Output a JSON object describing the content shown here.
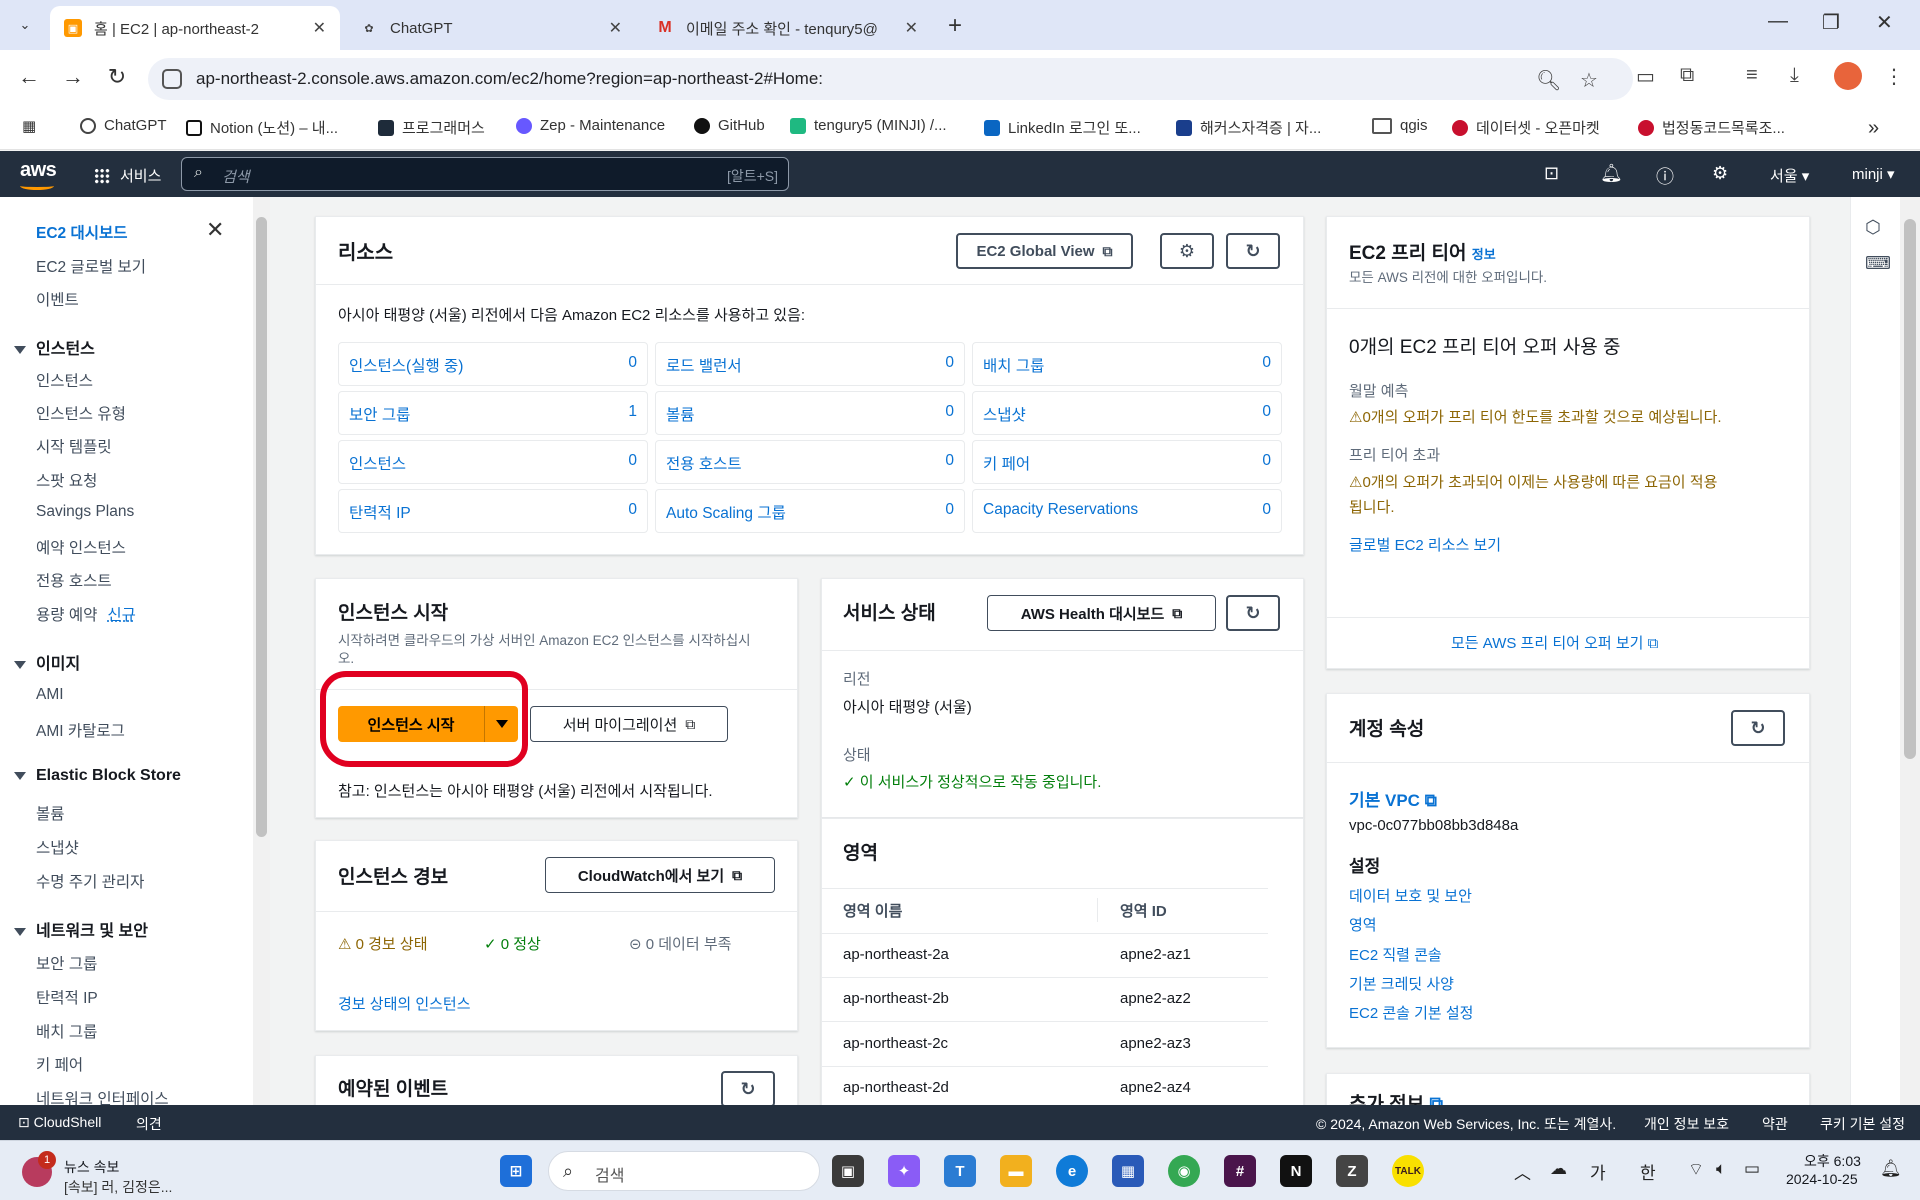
{
  "browser": {
    "tabs": [
      {
        "title": "홈 | EC2 | ap-northeast-2",
        "active": true
      },
      {
        "title": "ChatGPT",
        "active": false
      },
      {
        "title": "이메일 주소 확인 - tenqury5@",
        "active": false
      }
    ],
    "url": "ap-northeast-2.console.aws.amazon.com/ec2/home?region=ap-northeast-2#Home:",
    "bookmarks": [
      "ChatGPT",
      "Notion (노션) – 내...",
      "프로그래머스",
      "Zep - Maintenance",
      "GitHub",
      "tengury5 (MINJI) /...",
      "LinkedIn 로그인 또...",
      "해커스자격증 | 자...",
      "qgis",
      "데이터셋 - 오픈마켓",
      "법정동코드목록조..."
    ]
  },
  "aws_nav": {
    "logo": "aws",
    "services": "서비스",
    "search_placeholder": "검색",
    "search_shortcut": "[알트+S]",
    "region": "서울 ▾",
    "user": "minji ▾"
  },
  "sidebar": {
    "top_items": [
      "EC2 대시보드",
      "EC2 글로벌 보기",
      "이벤트"
    ],
    "sections": [
      {
        "title": "인스턴스",
        "items": [
          "인스턴스",
          "인스턴스 유형",
          "시작 템플릿",
          "스팟 요청",
          "Savings Plans",
          "예약 인스턴스",
          "전용 호스트",
          "용량 예약"
        ]
      },
      {
        "title": "이미지",
        "items": [
          "AMI",
          "AMI 카탈로그"
        ]
      },
      {
        "title": "Elastic Block Store",
        "items": [
          "볼륨",
          "스냅샷",
          "수명 주기 관리자"
        ]
      },
      {
        "title": "네트워크 및 보안",
        "items": [
          "보안 그룹",
          "탄력적 IP",
          "배치 그룹",
          "키 페어",
          "네트워크 인터페이스"
        ]
      }
    ],
    "new_badge": "신규"
  },
  "resources": {
    "title": "리소스",
    "global_view_btn": "EC2 Global View",
    "description": "아시아 태평양 (서울) 리전에서 다음 Amazon EC2 리소스를 사용하고 있음:",
    "items": [
      {
        "label": "인스턴스(실행 중)",
        "value": "0"
      },
      {
        "label": "로드 밸런서",
        "value": "0"
      },
      {
        "label": "배치 그룹",
        "value": "0"
      },
      {
        "label": "보안 그룹",
        "value": "1"
      },
      {
        "label": "볼륨",
        "value": "0"
      },
      {
        "label": "스냅샷",
        "value": "0"
      },
      {
        "label": "인스턴스",
        "value": "0"
      },
      {
        "label": "전용 호스트",
        "value": "0"
      },
      {
        "label": "키 페어",
        "value": "0"
      },
      {
        "label": "탄력적 IP",
        "value": "0"
      },
      {
        "label": "Auto Scaling 그룹",
        "value": "0"
      },
      {
        "label": "Capacity Reservations",
        "value": "0"
      }
    ]
  },
  "launch": {
    "title": "인스턴스 시작",
    "description_line1": "시작하려면 클라우드의 가상 서버인 Amazon EC2 인스턴스를 시작하십시",
    "description_line2": "오.",
    "launch_btn": "인스턴스 시작",
    "migrate_btn": "서버 마이그레이션",
    "note": "참고: 인스턴스는 아시아 태평양 (서울) 리전에서 시작됩니다."
  },
  "alarms": {
    "title": "인스턴스 경보",
    "cloudwatch_btn": "CloudWatch에서 보기",
    "alarm_state": "0 경보 상태",
    "ok_state": "0 정상",
    "insufficient": "0 데이터 부족",
    "link": "경보 상태의 인스턴스"
  },
  "events": {
    "title": "예약된 이벤트"
  },
  "service_health": {
    "title": "서비스 상태",
    "health_btn": "AWS Health 대시보드",
    "region_label": "리전",
    "region_value": "아시아 태평양 (서울)",
    "status_label": "상태",
    "status_value": "이 서비스가 정상적으로 작동 중입니다."
  },
  "zones": {
    "title": "영역",
    "col_name": "영역 이름",
    "col_id": "영역 ID",
    "rows": [
      {
        "name": "ap-northeast-2a",
        "id": "apne2-az1"
      },
      {
        "name": "ap-northeast-2b",
        "id": "apne2-az2"
      },
      {
        "name": "ap-northeast-2c",
        "id": "apne2-az3"
      },
      {
        "name": "ap-northeast-2d",
        "id": "apne2-az4"
      }
    ]
  },
  "free_tier": {
    "title": "EC2 프리 티어",
    "info": "정보",
    "subtitle": "모든 AWS 리전에 대한 오퍼입니다.",
    "usage": "0개의 EC2 프리 티어 오퍼 사용 중",
    "forecast_label": "월말 예측",
    "forecast_text": "0개의 오퍼가 프리 티어 한도를 초과할 것으로 예상됩니다.",
    "exceeded_label": "프리 티어 초과",
    "exceeded_line1": "0개의 오퍼가 초과되어 이제는 사용량에 따른 요금이 적용",
    "exceeded_line2": "됩니다.",
    "global_link": "글로벌 EC2 리소스 보기",
    "all_offers_link": "모든 AWS 프리 티어 오퍼 보기"
  },
  "account": {
    "title": "계정 속성",
    "vpc_label": "기본 VPC",
    "vpc_id": "vpc-0c077bb08bb3d848a",
    "settings_label": "설정",
    "links": [
      "데이터 보호 및 보안",
      "영역",
      "EC2 직렬 콘솔",
      "기본 크레딧 사양",
      "EC2 콘솔 기본 설정"
    ],
    "more_info": "추가 정보"
  },
  "footer": {
    "cloudshell": "CloudShell",
    "feedback": "의견",
    "copyright": "© 2024, Amazon Web Services, Inc. 또는 계열사.",
    "privacy": "개인 정보 보호",
    "terms": "약관",
    "cookies": "쿠키 기본 설정"
  },
  "taskbar": {
    "news_title": "뉴스 속보",
    "news_text": "[속보] 러, 김정은...",
    "news_badge": "1",
    "search_placeholder": "검색",
    "ime1": "가",
    "ime2": "한",
    "time": "오후 6:03",
    "date": "2024-10-25"
  },
  "colors": {
    "aws_nav": "#232f3e",
    "accent_orange": "#ff9900",
    "link_blue": "#0972d3",
    "warning": "#8d6605",
    "success": "#037f0c",
    "annotation_red": "#e00020"
  }
}
